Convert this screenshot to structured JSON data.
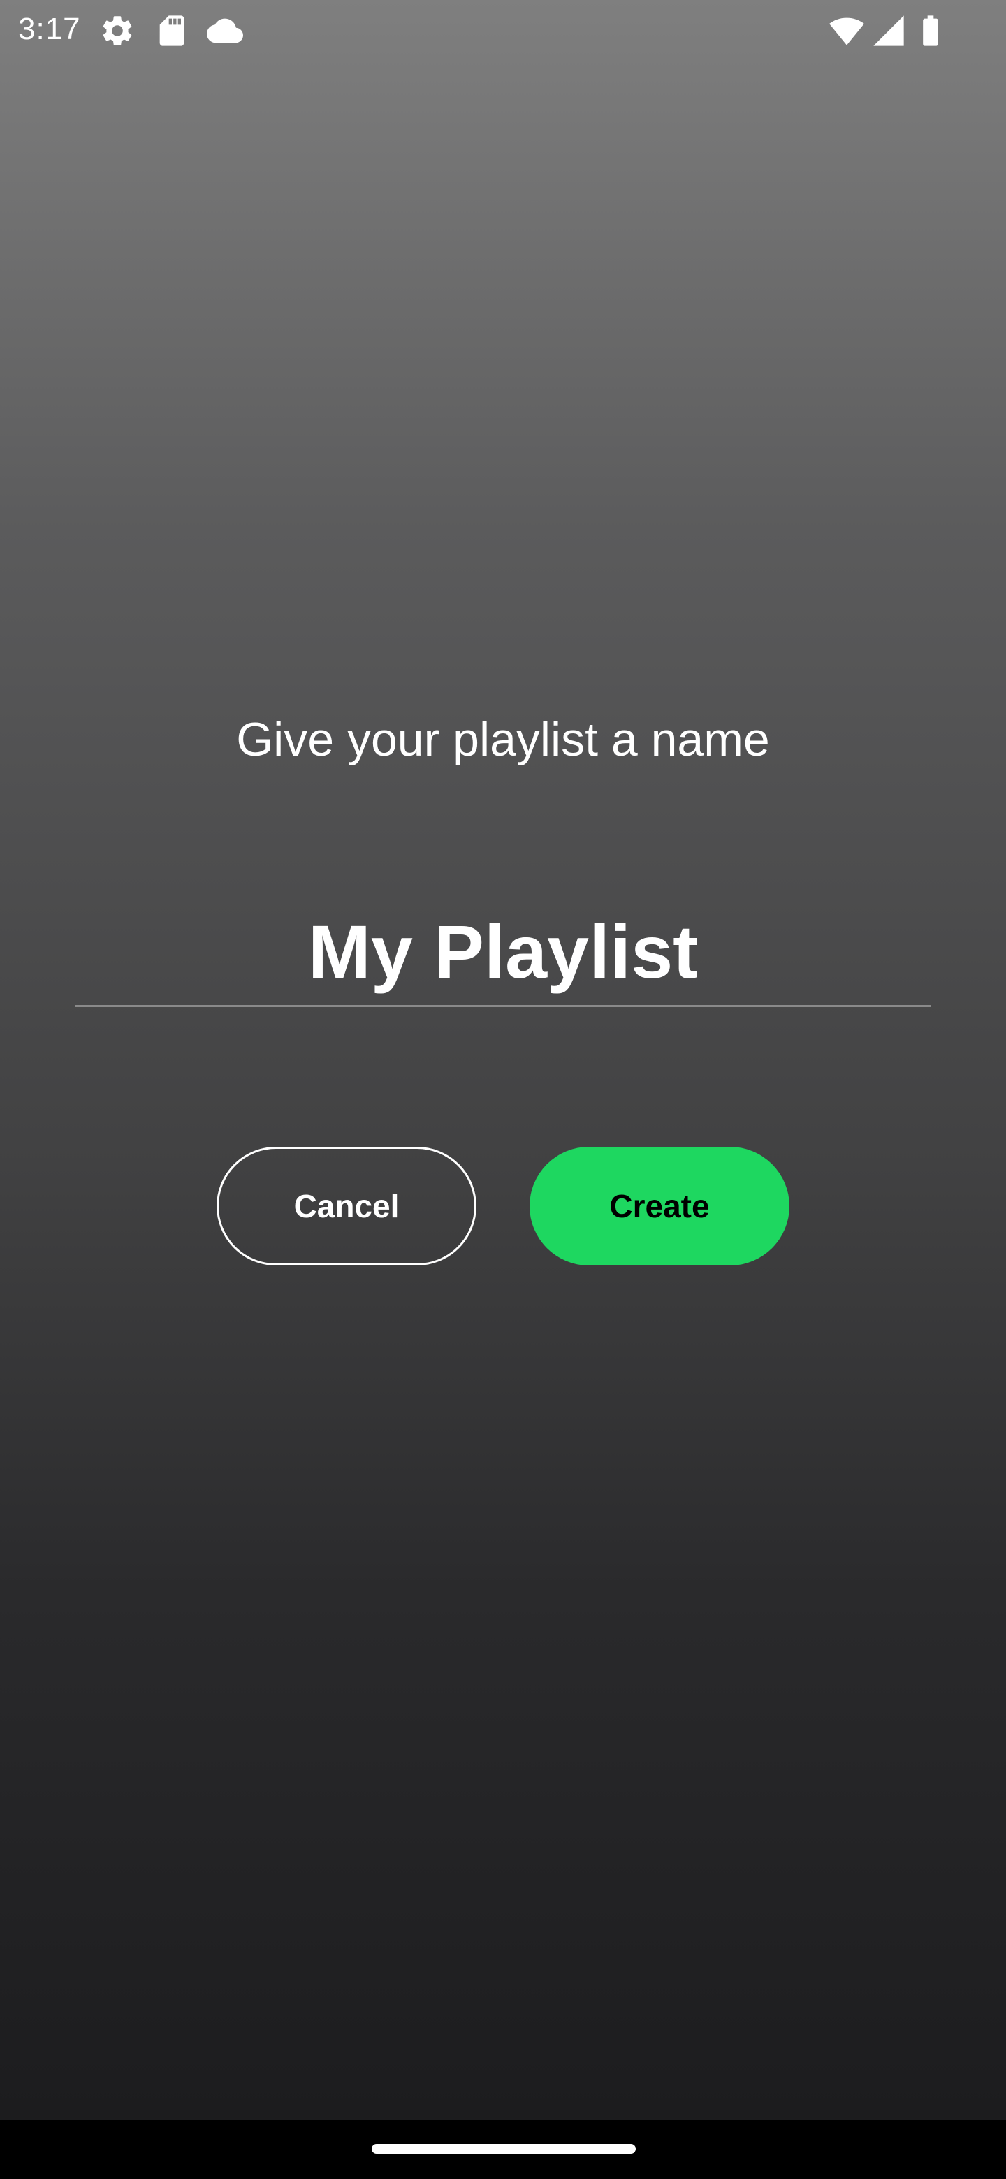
{
  "status_bar": {
    "time": "3:17",
    "icons_left": [
      "settings-gear-icon",
      "sd-card-icon",
      "cloud-icon"
    ],
    "icons_right": [
      "wifi-icon",
      "cellular-signal-icon",
      "battery-icon"
    ]
  },
  "dialog": {
    "title": "Give your playlist a name",
    "name_input_value": "My Playlist",
    "cancel_label": "Cancel",
    "create_label": "Create"
  },
  "colors": {
    "accent": "#1ed760",
    "background_top": "#7f7f7f",
    "background_bottom": "#1c1c1e"
  }
}
